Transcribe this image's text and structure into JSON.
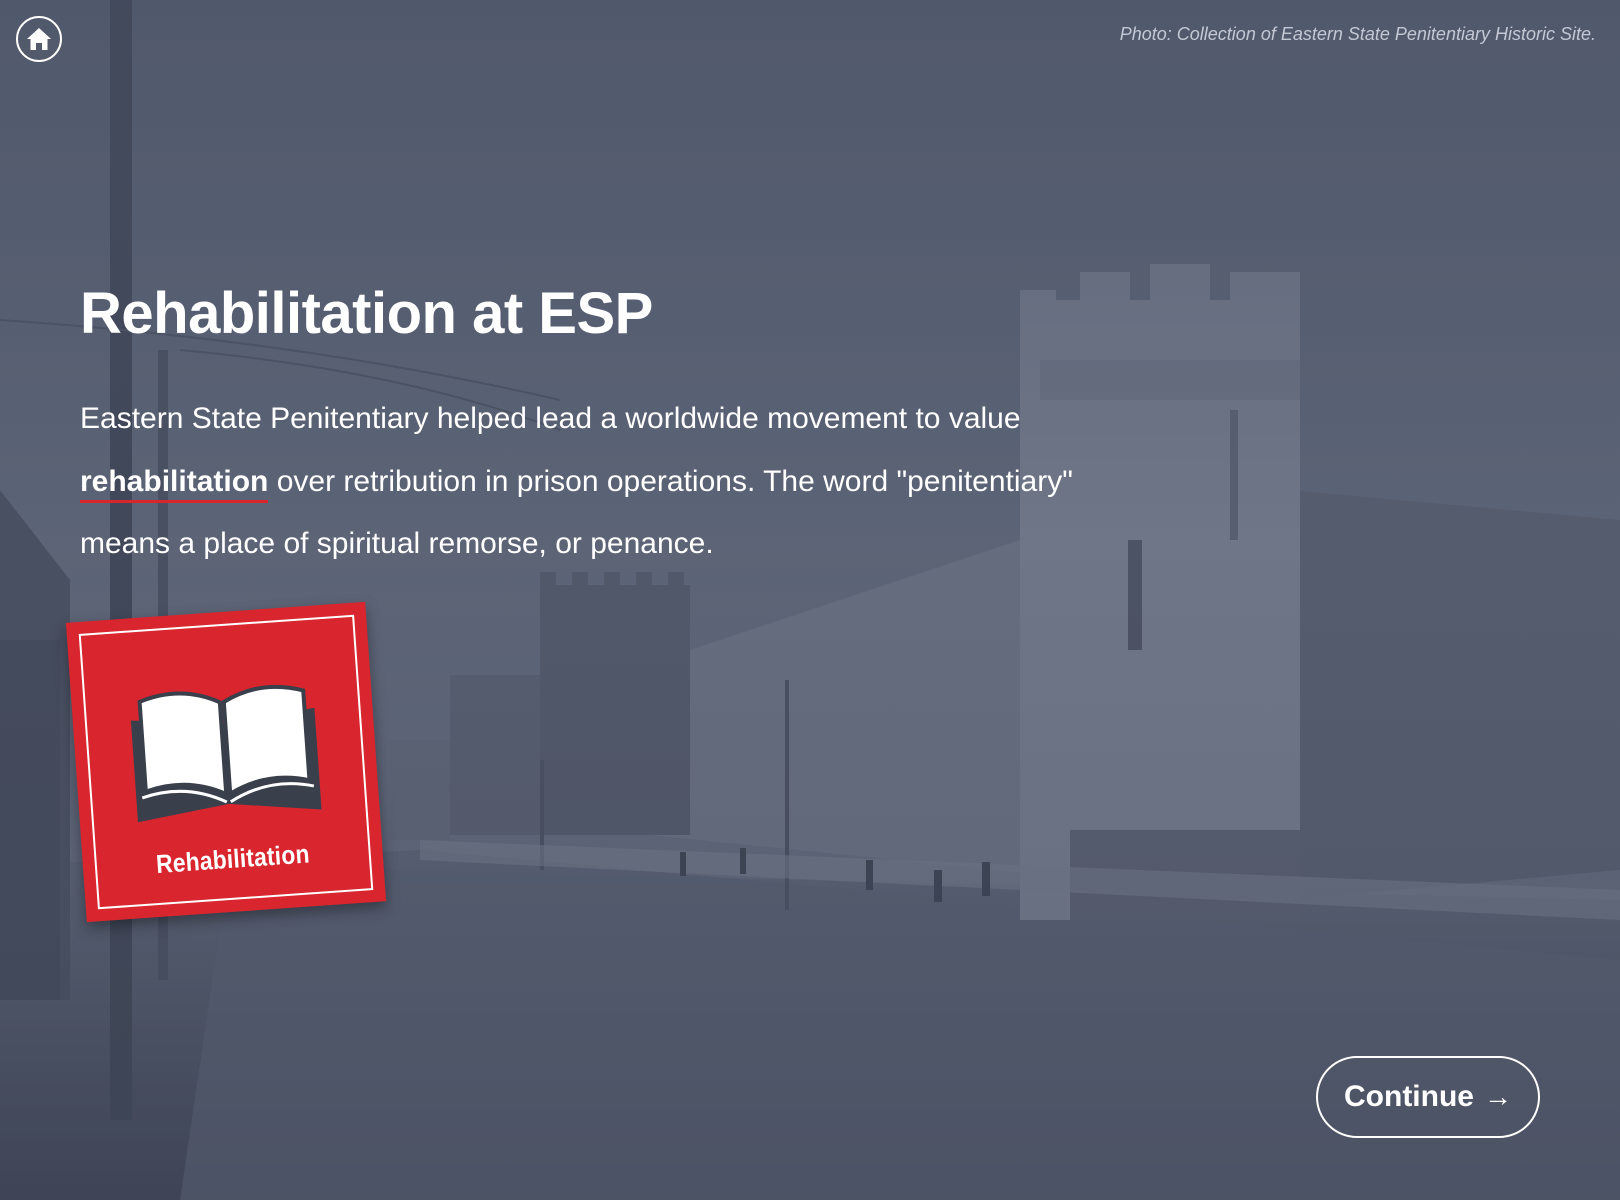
{
  "photo_credit": "Photo: Collection of Eastern State Penitentiary Historic Site.",
  "home": {
    "icon": "home-icon"
  },
  "title": "Rehabilitation at ESP",
  "body": {
    "intro": "Eastern State Penitentiary helped lead a worldwide movement to value",
    "keyword": "rehabilitation",
    "rest": " over retribution in prison operations. The word \"penitentiary\" means a place of spiritual remorse, or penance."
  },
  "badge": {
    "icon": "open-book-icon",
    "label": "Rehabilitation"
  },
  "continue": {
    "label": "Continue",
    "icon": "arrow-right-icon"
  },
  "colors": {
    "accent": "#d9262e",
    "overlay": "#4d5568",
    "text": "#ffffff"
  }
}
